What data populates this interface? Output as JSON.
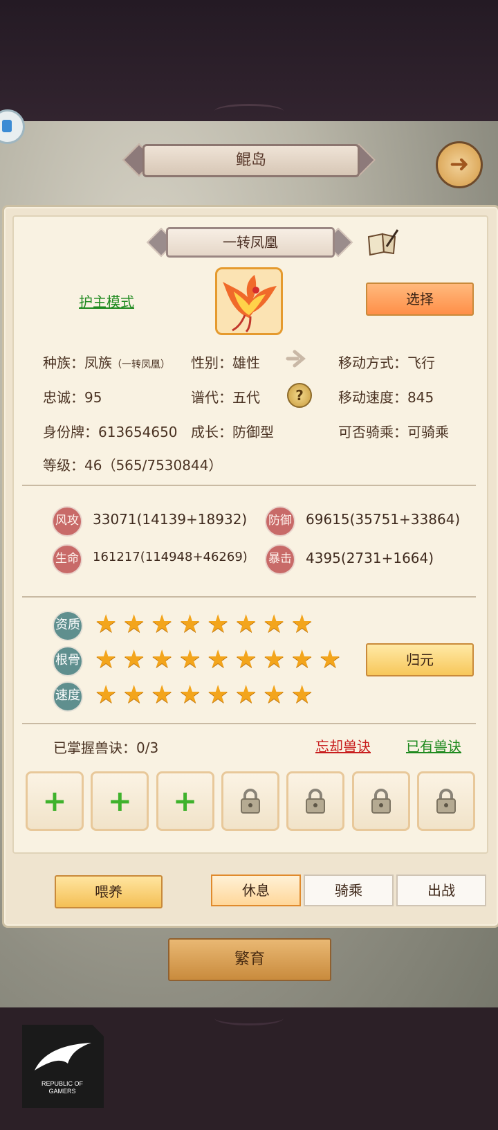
{
  "header": {
    "island_title": "鲲岛"
  },
  "pet": {
    "name": "一转凤凰",
    "guard_mode": "护主模式",
    "select_label": "选择",
    "race": "种族：凤族",
    "race_note": "（一转凤凰）",
    "gender": "性别：雄性",
    "movement": "移动方式：飞行",
    "loyalty": "忠诚：95",
    "generation": "谱代：五代",
    "move_speed": "移动速度：845",
    "id_tag": "身份牌：613654650",
    "growth": "成长：防御型",
    "rideable": "可否骑乘：可骑乘",
    "level": "等级：46（565/7530844）"
  },
  "attributes": [
    {
      "badge": "风攻",
      "value": "33071(14139+18932)"
    },
    {
      "badge": "防御",
      "value": "69615(35751+33864)"
    },
    {
      "badge": "生命",
      "value": "161217(114948+46269)"
    },
    {
      "badge": "暴击",
      "value": "4395(2731+1664)"
    }
  ],
  "aptitudes": [
    {
      "label": "资质",
      "stars": 8
    },
    {
      "label": "根骨",
      "stars": 9
    },
    {
      "label": "速度",
      "stars": 8
    }
  ],
  "return_label": "归元",
  "skills": {
    "mastered": "已掌握兽诀：0/3",
    "forget": "忘却兽诀",
    "owned": "已有兽诀",
    "slots": [
      "plus",
      "plus",
      "plus",
      "lock",
      "lock",
      "lock",
      "lock"
    ]
  },
  "actions": {
    "feed": "喂养",
    "rest": "休息",
    "ride": "骑乘",
    "fight": "出战"
  },
  "breed_label": "繁育",
  "watermark": {
    "line1": "REPUBLIC OF",
    "line2": "GAMERS"
  },
  "colors": {
    "accent": "#ff8f48",
    "gold": "#f3a51c",
    "link_green": "#1f8a1f",
    "link_red": "#c81e1e"
  }
}
